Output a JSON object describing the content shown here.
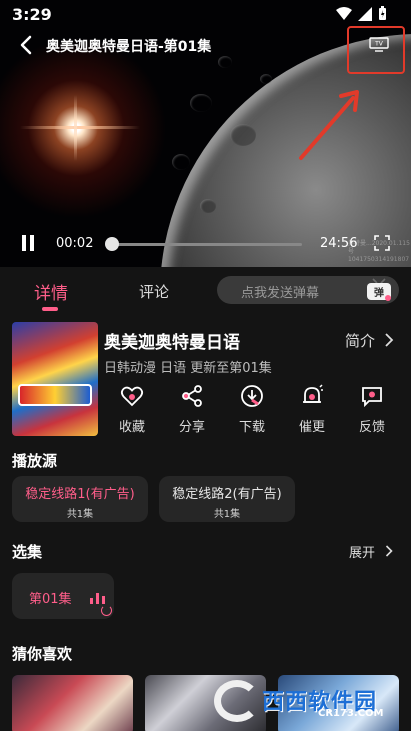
{
  "status_bar": {
    "time": "3:29"
  },
  "player": {
    "title": "奥美迦奥特曼日语-第01集",
    "current_time": "00:02",
    "duration": "24:56",
    "progress": 0.01,
    "watermark_line1": "奥特曼...2020.01.115号",
    "watermark_line2": "1041750314191807",
    "cast_button_label": "TV",
    "highlight_color": "#e23a2a"
  },
  "tabs": [
    {
      "label": "详情",
      "active": true
    },
    {
      "label": "评论",
      "active": false
    }
  ],
  "danmu": {
    "placeholder": "点我发送弹幕",
    "icon": "danmu-tv-icon",
    "icon_text": "弹"
  },
  "show": {
    "title": "奥美迦奥特曼日语",
    "meta": "日韩动漫 日语 更新至第01集",
    "intro_label": "简介"
  },
  "actions": [
    {
      "label": "收藏",
      "icon": "heart-icon"
    },
    {
      "label": "分享",
      "icon": "share-icon"
    },
    {
      "label": "下载",
      "icon": "download-icon"
    },
    {
      "label": "催更",
      "icon": "bell-icon"
    },
    {
      "label": "反馈",
      "icon": "feedback-icon"
    }
  ],
  "sources": {
    "title": "播放源",
    "items": [
      {
        "name": "稳定线路1(有广告)",
        "count": "共1集",
        "active": true
      },
      {
        "name": "稳定线路2(有广告)",
        "count": "共1集",
        "active": false
      }
    ]
  },
  "episodes": {
    "title": "选集",
    "expand_label": "展开",
    "items": [
      {
        "label": "第01集",
        "active": true
      }
    ]
  },
  "recommend": {
    "title": "猜你喜欢"
  },
  "site_watermark": {
    "text": "西西软件园",
    "domain": "CR173.COM"
  },
  "colors": {
    "accent": "#ff5e8a",
    "background": "#141414",
    "card": "#262626"
  }
}
